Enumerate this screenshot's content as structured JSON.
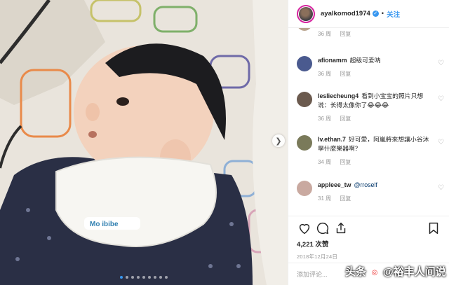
{
  "post": {
    "username": "ayalkomod1974",
    "follow_label": "关注",
    "separator": "•",
    "likes": "4,221 次赞",
    "date": "2018年12月24日",
    "add_comment_placeholder": "添加评论...",
    "carousel": {
      "total": 9,
      "active_index": 0
    }
  },
  "comments": [
    {
      "user": "",
      "text": "",
      "time": "36 周",
      "reply": "回复",
      "has_heart": true,
      "avatar_color": "#b9a38e"
    },
    {
      "user": "afionamm",
      "text": "超级可爱呐",
      "time": "36 周",
      "reply": "回复",
      "has_heart": true,
      "avatar_color": "#4a5a8f"
    },
    {
      "user": "lesliecheung4",
      "text": "看到小宝宝的照片只想说：长得太像你了😂😂😂",
      "time": "36 周",
      "reply": "回复",
      "has_heart": true,
      "avatar_color": "#6b5a4e"
    },
    {
      "user": "lv.ethan.7",
      "text": "好可愛，阿嵐將來想讓小谷沐學什麼樂器啊？",
      "time": "34 周",
      "reply": "回复",
      "has_heart": true,
      "avatar_color": "#7a7a5a"
    },
    {
      "user": "appleee_tw",
      "mention": "@rroself",
      "text": "",
      "time": "31 周",
      "reply": "回复",
      "has_heart": true,
      "avatar_color": "#c9a9a0"
    }
  ],
  "icons": {
    "like": "heart-icon",
    "comment": "comment-icon",
    "share": "share-icon",
    "save": "bookmark-icon",
    "next": "chevron-right-icon"
  },
  "watermark": {
    "prefix": "头条",
    "author": "@裕丰人间说"
  },
  "colors": {
    "link_blue": "#3897f0",
    "meta_gray": "#999999",
    "verified_blue": "#3897f0"
  }
}
